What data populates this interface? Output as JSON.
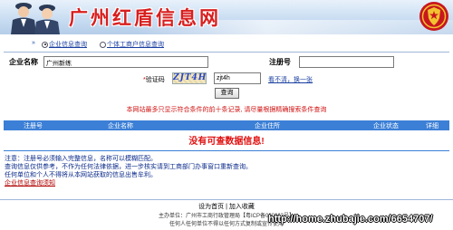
{
  "header": {
    "title": "广州红盾信息网"
  },
  "tabs": [
    {
      "label": "企业信息查询",
      "selected": true
    },
    {
      "label": "个体工商户信息查询",
      "selected": false
    }
  ],
  "search": {
    "company_label": "企业名称",
    "company_value": "广州新练",
    "reg_label": "注册号",
    "reg_value": "",
    "captcha_label": "验证码",
    "captcha_image_text": "ZJT4H",
    "captcha_value": "zjt4h",
    "refresh_text": "看不清，换一张",
    "query_button": "查询"
  },
  "notice": "本网站最多只显示符合条件的前十条记录, 请尽量根据精确搜索条件查询",
  "results": {
    "columns": [
      "注册号",
      "企业名称",
      "企业住所",
      "企业状态",
      "详细"
    ],
    "empty_message": "没有可查数据信息!"
  },
  "notes": {
    "lines": [
      "注意：注册号必须输入完整信息，名称可以模糊匹配。",
      "查询信息仅供参考，不作为任何法律依据，进一步核实请到工商部门办事窗口重新查询。",
      "任何单位和个人不得将从本网站获取的信息出售牟利。"
    ],
    "link": "企业信息查询须知"
  },
  "footer": {
    "set_home": "设为首页",
    "separator": "|",
    "bookmark": "加入收藏",
    "sponsor": "主办单位：广州市工商行政管理局【粤ICP备030863号】",
    "copyright": "任何人任何单位不得以任何方式复制或宣传使用",
    "watermark": "http://home.zhubajie.com/6654707/"
  },
  "colors": {
    "title_red": "#d81e1e",
    "header_blue": "#3b7fd6",
    "error_red": "#e01010",
    "link_blue": "#1a3fa0"
  }
}
